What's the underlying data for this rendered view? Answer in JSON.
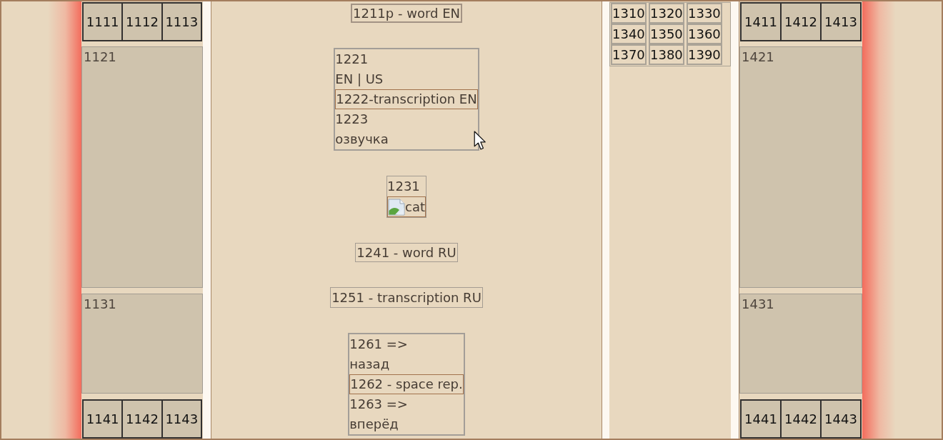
{
  "left_panel": {
    "top_cells": [
      "1111",
      "1112",
      "1113"
    ],
    "upper_section": "1121",
    "lower_section": "1131",
    "bottom_cells": [
      "1141",
      "1142",
      "1143"
    ]
  },
  "card": {
    "word_en": "1211p - word EN",
    "pronunciation": {
      "label": "1221",
      "accent": "EN | US",
      "transcription": "1222-transcription EN",
      "audio_label": "1223",
      "audio_text": "озвучка"
    },
    "picture": {
      "label": "1231",
      "alt": "cat"
    },
    "word_ru": "1241 - word RU",
    "transcription_ru": "1251 - transcription RU",
    "navigation": {
      "back_label": "1261 =>",
      "back_text": "назад",
      "review": "1262 - space rep.",
      "forward_label": "1263 =>",
      "forward_text": "вперёд"
    }
  },
  "number_grid": [
    "1310",
    "1320",
    "1330",
    "1340",
    "1350",
    "1360",
    "1370",
    "1380",
    "1390"
  ],
  "right_panel": {
    "top_cells": [
      "1411",
      "1412",
      "1413"
    ],
    "upper_section": "1421",
    "lower_section": "1431",
    "bottom_cells": [
      "1441",
      "1442",
      "1443"
    ]
  }
}
